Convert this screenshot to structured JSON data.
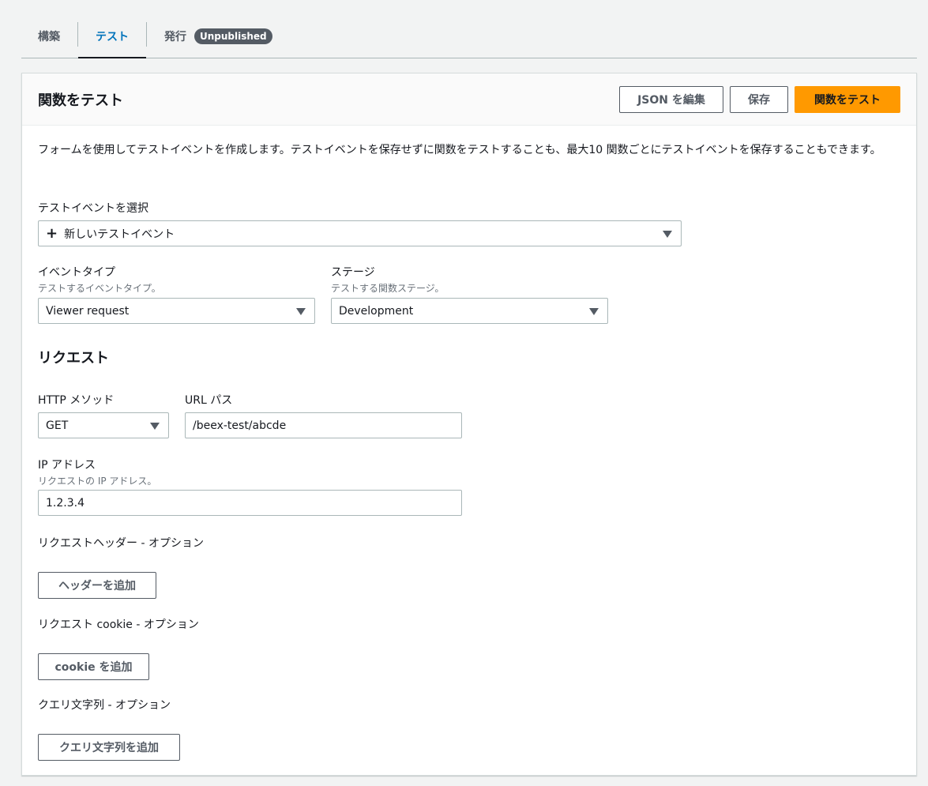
{
  "tabs": [
    {
      "label": "構築"
    },
    {
      "label": "テスト"
    },
    {
      "label": "発行",
      "badge": "Unpublished"
    }
  ],
  "panel": {
    "title": "関数をテスト",
    "buttons": {
      "edit_json": "JSON を編集",
      "save": "保存",
      "test": "関数をテスト"
    },
    "description": "フォームを使用してテストイベントを作成します。テストイベントを保存せずに関数をテストすることも、最大10 関数ごとにテストイベントを保存することもできます。",
    "test_event": {
      "label": "テストイベントを選択",
      "value": "新しいテストイベント"
    },
    "event_type": {
      "label": "イベントタイプ",
      "sublabel": "テストするイベントタイプ。",
      "value": "Viewer request"
    },
    "stage": {
      "label": "ステージ",
      "sublabel": "テストする関数ステージ。",
      "value": "Development"
    },
    "request": {
      "title": "リクエスト",
      "http_method": {
        "label": "HTTP メソッド",
        "value": "GET"
      },
      "url_path": {
        "label": "URL パス",
        "value": "/beex-test/abcde"
      },
      "ip": {
        "label": "IP アドレス",
        "sublabel": "リクエストの IP アドレス。",
        "value": "1.2.3.4"
      },
      "headers": {
        "label": "リクエストヘッダー - オプション",
        "button": "ヘッダーを追加"
      },
      "cookies": {
        "label": "リクエスト cookie - オプション",
        "button": "cookie を追加"
      },
      "query": {
        "label": "クエリ文字列 - オプション",
        "button": "クエリ文字列を追加"
      }
    }
  },
  "colors": {
    "accent": "#ff9900",
    "active_tab": "#0073bb",
    "badge_bg": "#545b64"
  }
}
